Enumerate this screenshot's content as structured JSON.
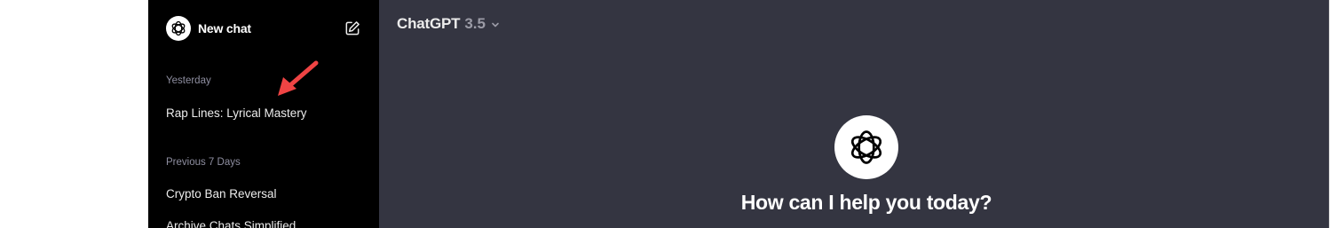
{
  "sidebar": {
    "new_chat_label": "New chat",
    "sections": [
      {
        "label": "Yesterday",
        "items": [
          "Rap Lines: Lyrical Mastery"
        ]
      },
      {
        "label": "Previous 7 Days",
        "items": [
          "Crypto Ban Reversal",
          "Archive Chats Simplified"
        ]
      }
    ]
  },
  "header": {
    "model_name": "ChatGPT",
    "model_version": "3.5"
  },
  "main": {
    "greeting": "How can I help you today?"
  },
  "colors": {
    "sidebar_bg": "#000000",
    "main_bg": "#343541",
    "annotation_arrow": "#ef4444"
  },
  "icons": {
    "logo": "openai-logo-icon",
    "edit": "edit-icon",
    "chevron": "chevron-down-icon",
    "annotation": "red-arrow-annotation"
  }
}
